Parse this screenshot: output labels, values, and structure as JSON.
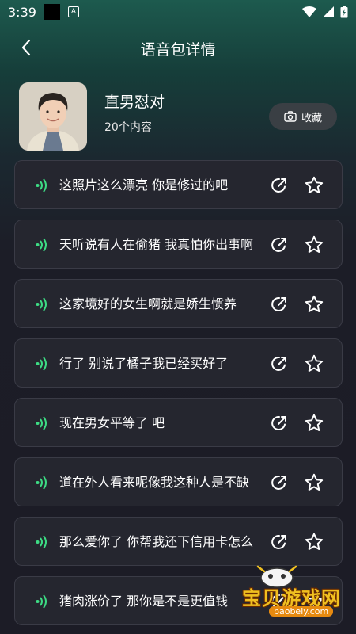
{
  "status": {
    "time": "3:39",
    "notif_label": "A"
  },
  "header": {
    "title": "语音包详情"
  },
  "profile": {
    "name": "直男怼对",
    "count": "20个内容",
    "fav_label": "收藏"
  },
  "items": [
    {
      "text": "这照片这么漂亮 你是修过的吧"
    },
    {
      "text": "天听说有人在偷猪 我真怕你出事啊"
    },
    {
      "text": "这家境好的女生啊就是娇生惯养"
    },
    {
      "text": "行了 别说了橘子我已经买好了"
    },
    {
      "text": "现在男女平等了 吧"
    },
    {
      "text": "道在外人看来呢像我这种人是不缺"
    },
    {
      "text": "那么爱你了 你帮我还下信用卡怎么"
    },
    {
      "text": "猪肉涨价了 那你是不是更值钱"
    }
  ],
  "watermark": {
    "text": "宝贝游戏网",
    "url": "baobeiy.com"
  },
  "colors": {
    "accent_wave": "#3ddc84",
    "item_bg": "#25262f",
    "fav_bg": "#3a3f44"
  }
}
